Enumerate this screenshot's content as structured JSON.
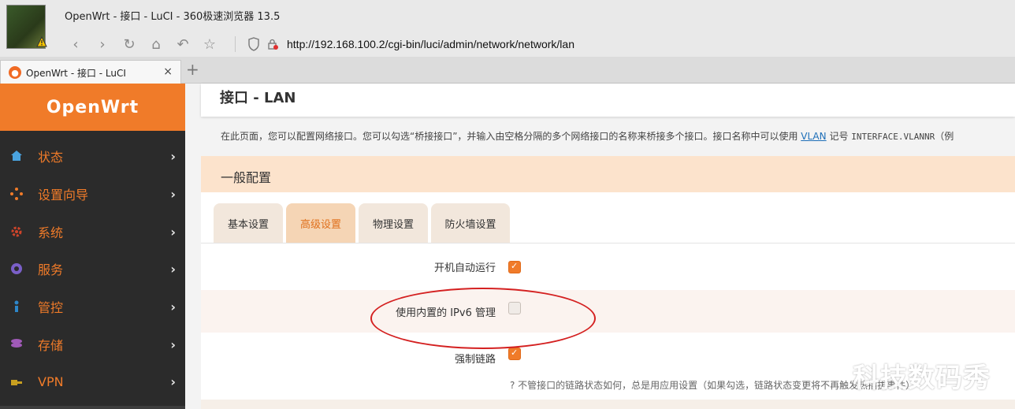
{
  "window": {
    "title": "OpenWrt - 接口 - LuCI - 360极速浏览器 13.5",
    "url": "http://192.168.100.2/cgi-bin/luci/admin/network/network/lan",
    "tab_label": "OpenWrt - 接口 - LuCI",
    "tab_close": "×",
    "new_tab": "+"
  },
  "nav": {
    "back": "‹",
    "forward": "›",
    "reload": "↻",
    "home": "⌂",
    "undo": "↶",
    "star": "☆"
  },
  "sidebar": {
    "brand": "OpenWrt",
    "items": [
      {
        "label": "状态",
        "icon": "home-icon",
        "chevron": "›"
      },
      {
        "label": "设置向导",
        "icon": "wizard-icon",
        "chevron": "›"
      },
      {
        "label": "系统",
        "icon": "gear-icon",
        "chevron": "›"
      },
      {
        "label": "服务",
        "icon": "service-icon",
        "chevron": "›"
      },
      {
        "label": "管控",
        "icon": "control-icon",
        "chevron": "›"
      },
      {
        "label": "存储",
        "icon": "storage-icon",
        "chevron": "›"
      },
      {
        "label": "VPN",
        "icon": "vpn-icon",
        "chevron": "›"
      }
    ]
  },
  "main": {
    "page_title": "接口 - LAN",
    "description_prefix": "在此页面，您可以配置网络接口。您可以勾选“桥接接口”，并输入由空格分隔的多个网络接口的名称来桥接多个接口。接口名称中可以使用 ",
    "description_link": "VLAN",
    "description_mid": " 记号 ",
    "description_code": "INTERFACE.VLANNR",
    "description_suffix": "（例",
    "section_title": "一般配置",
    "tabs": [
      {
        "label": "基本设置",
        "active": false
      },
      {
        "label": "高级设置",
        "active": true
      },
      {
        "label": "物理设置",
        "active": false
      },
      {
        "label": "防火墙设置",
        "active": false
      }
    ],
    "options": [
      {
        "label": "开机自动运行",
        "checked": true
      },
      {
        "label": "使用内置的 IPv6 管理",
        "checked": false
      },
      {
        "label": "强制链路",
        "checked": true
      }
    ],
    "hint": "? 不管接口的链路状态如何，总是用应用设置（如果勾选，链路状态变更将不再触发热插拔事件）"
  },
  "watermark": "科技数码秀",
  "colors": {
    "accent": "#f07b29",
    "sidebar_bg": "#2b2b2b",
    "section_head_bg": "#fce3cc",
    "annotation": "#d42020"
  }
}
